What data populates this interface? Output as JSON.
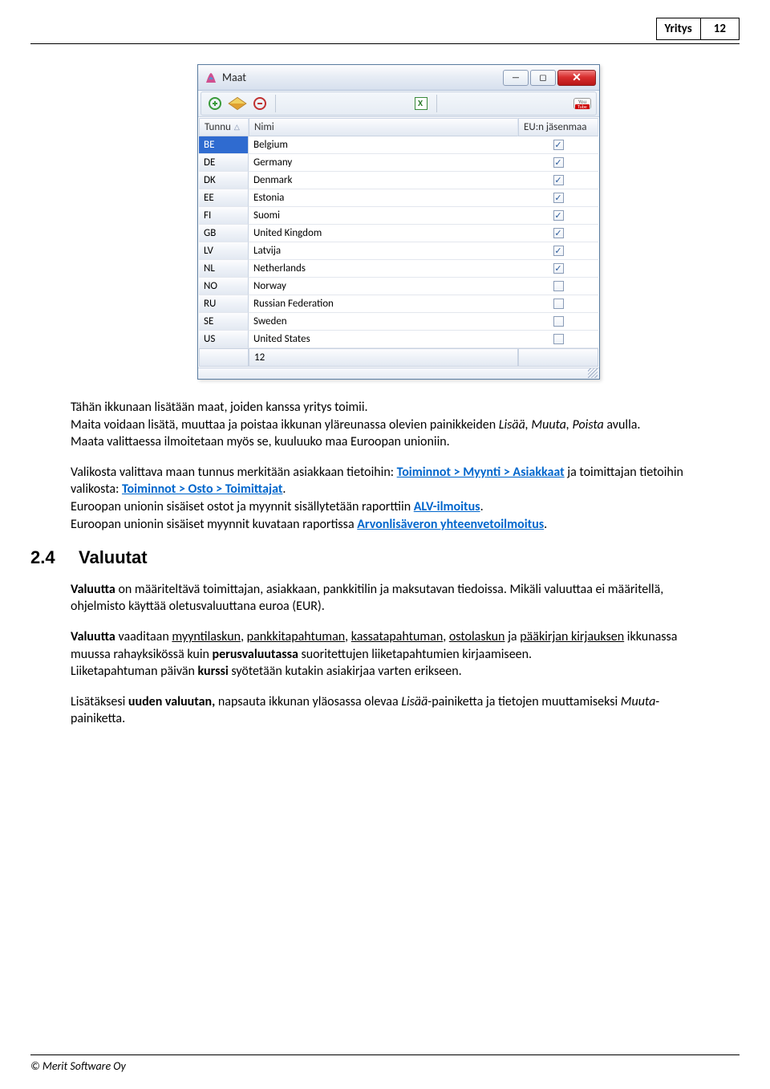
{
  "header": {
    "label": "Yritys",
    "page": "12"
  },
  "window": {
    "title": "Maat",
    "columns": {
      "code": "Tunnu",
      "name": "Nimi",
      "eu": "EU:n jäsenmaa"
    },
    "rows": [
      {
        "code": "BE",
        "name": "Belgium",
        "eu": true,
        "selected": true
      },
      {
        "code": "DE",
        "name": "Germany",
        "eu": true
      },
      {
        "code": "DK",
        "name": "Denmark",
        "eu": true
      },
      {
        "code": "EE",
        "name": "Estonia",
        "eu": true
      },
      {
        "code": "FI",
        "name": "Suomi",
        "eu": true
      },
      {
        "code": "GB",
        "name": "United Kingdom",
        "eu": true
      },
      {
        "code": "LV",
        "name": "Latvija",
        "eu": true
      },
      {
        "code": "NL",
        "name": "Netherlands",
        "eu": true
      },
      {
        "code": "NO",
        "name": "Norway",
        "eu": false
      },
      {
        "code": "RU",
        "name": "Russian Federation",
        "eu": false
      },
      {
        "code": "SE",
        "name": "Sweden",
        "eu": false
      },
      {
        "code": "US",
        "name": "United States",
        "eu": false
      }
    ],
    "footer_count": "12"
  },
  "text": {
    "p1": "Tähän ikkunaan lisätään maat, joiden kanssa yritys toimii.",
    "p1b_a": "Maita voidaan lisätä, muuttaa ja poistaa ikkunan yläreunassa olevien painikkeiden ",
    "p1b_i": "Lisää, Muuta, Poista",
    "p1b_b": " avulla.",
    "p1c": "Maata valittaessa ilmoitetaan myös se, kuuluuko maa Euroopan unioniin.",
    "p2a": "Valikosta valittava maan tunnus merkitään asiakkaan tietoihin: ",
    "link1": "Toiminnot > Myynti > Asiakkaat",
    "p2b": " ja toimittajan tietoihin valikosta: ",
    "link2": "Toiminnot > Osto > Toimittajat",
    "p2c": ".",
    "p3a": "Euroopan unionin sisäiset ostot ja myynnit sisällytetään raporttiin ",
    "link3": "ALV-ilmoitus",
    "p3b": ".",
    "p4a": "Euroopan unionin sisäiset myynnit kuvataan raportissa ",
    "link4": "Arvonlisäveron yhteenvetoilmoitus",
    "p4b": ".",
    "sec_num": "2.4",
    "sec_title": "Valuutat",
    "p5a": "Valuutta",
    "p5b": " on määriteltävä toimittajan, asiakkaan, pankkitilin ja maksutavan tiedoissa. Mikäli valuuttaa ei määritellä, ohjelmisto käyttää oletusvaluuttana euroa (EUR).",
    "p6a": "Valuutta",
    "p6b": " vaaditaan  ",
    "l6a": "myyntilaskun",
    "p6c": ", ",
    "l6b": "pankkitapahtuman",
    "p6d": ", ",
    "l6c": "kassatapahtuman",
    "p6e": ", ",
    "l6d": "ostolaskun",
    "p6f": " ja ",
    "l6e": "pääkirjan kirjauksen",
    "p6g": " ikkunassa muussa rahayksikössä kuin ",
    "p6h": "perusvaluutassa",
    "p6i": " suoritettujen liiketapahtumien kirjaamiseen.",
    "p7a": "Liiketapahtuman päivän ",
    "p7b": "kurssi",
    "p7c": " syötetään kutakin asiakirjaa varten erikseen.",
    "p8a": "Lisätäksesi ",
    "p8b": "uuden valuutan,",
    "p8c": " napsauta ikkunan yläosassa olevaa ",
    "p8d": "Lisää",
    "p8e": "-painiketta ja tietojen muuttamiseksi ",
    "p8f": "Muuta",
    "p8g": "-painiketta."
  },
  "footer": "© Merit Software Oy"
}
